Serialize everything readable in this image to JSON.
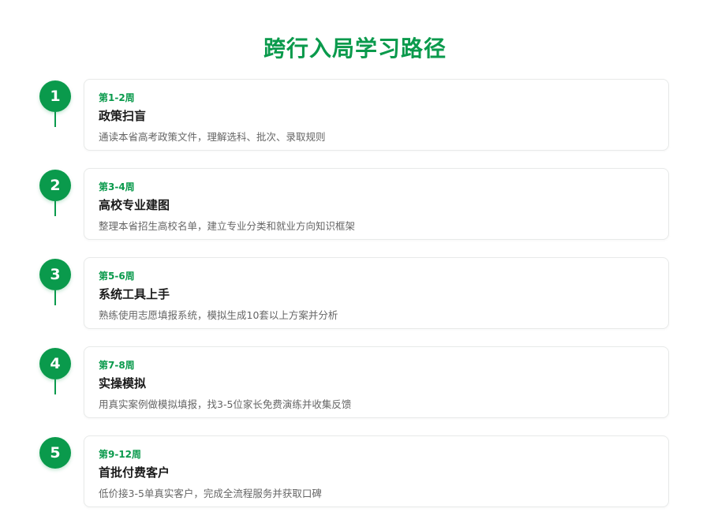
{
  "page": {
    "title": "跨行入局学习路径"
  },
  "colors": {
    "accent": "#0a9a4c",
    "title_text": "#1a1a1a",
    "desc_text": "#666666",
    "card_border": "#e8eae9"
  },
  "steps": [
    {
      "number": "1",
      "week": "第1-2周",
      "title": "政策扫盲",
      "description": "通读本省高考政策文件，理解选科、批次、录取规则",
      "has_connector": true
    },
    {
      "number": "2",
      "week": "第3-4周",
      "title": "高校专业建图",
      "description": "整理本省招生高校名单，建立专业分类和就业方向知识框架",
      "has_connector": true
    },
    {
      "number": "3",
      "week": "第5-6周",
      "title": "系统工具上手",
      "description": "熟练使用志愿填报系统，模拟生成10套以上方案并分析",
      "has_connector": true
    },
    {
      "number": "4",
      "week": "第7-8周",
      "title": "实操模拟",
      "description": "用真实案例做模拟填报，找3-5位家长免费演练并收集反馈",
      "has_connector": true
    },
    {
      "number": "5",
      "week": "第9-12周",
      "title": "首批付费客户",
      "description": "低价接3-5单真实客户，完成全流程服务并获取口碑",
      "has_connector": false
    }
  ]
}
